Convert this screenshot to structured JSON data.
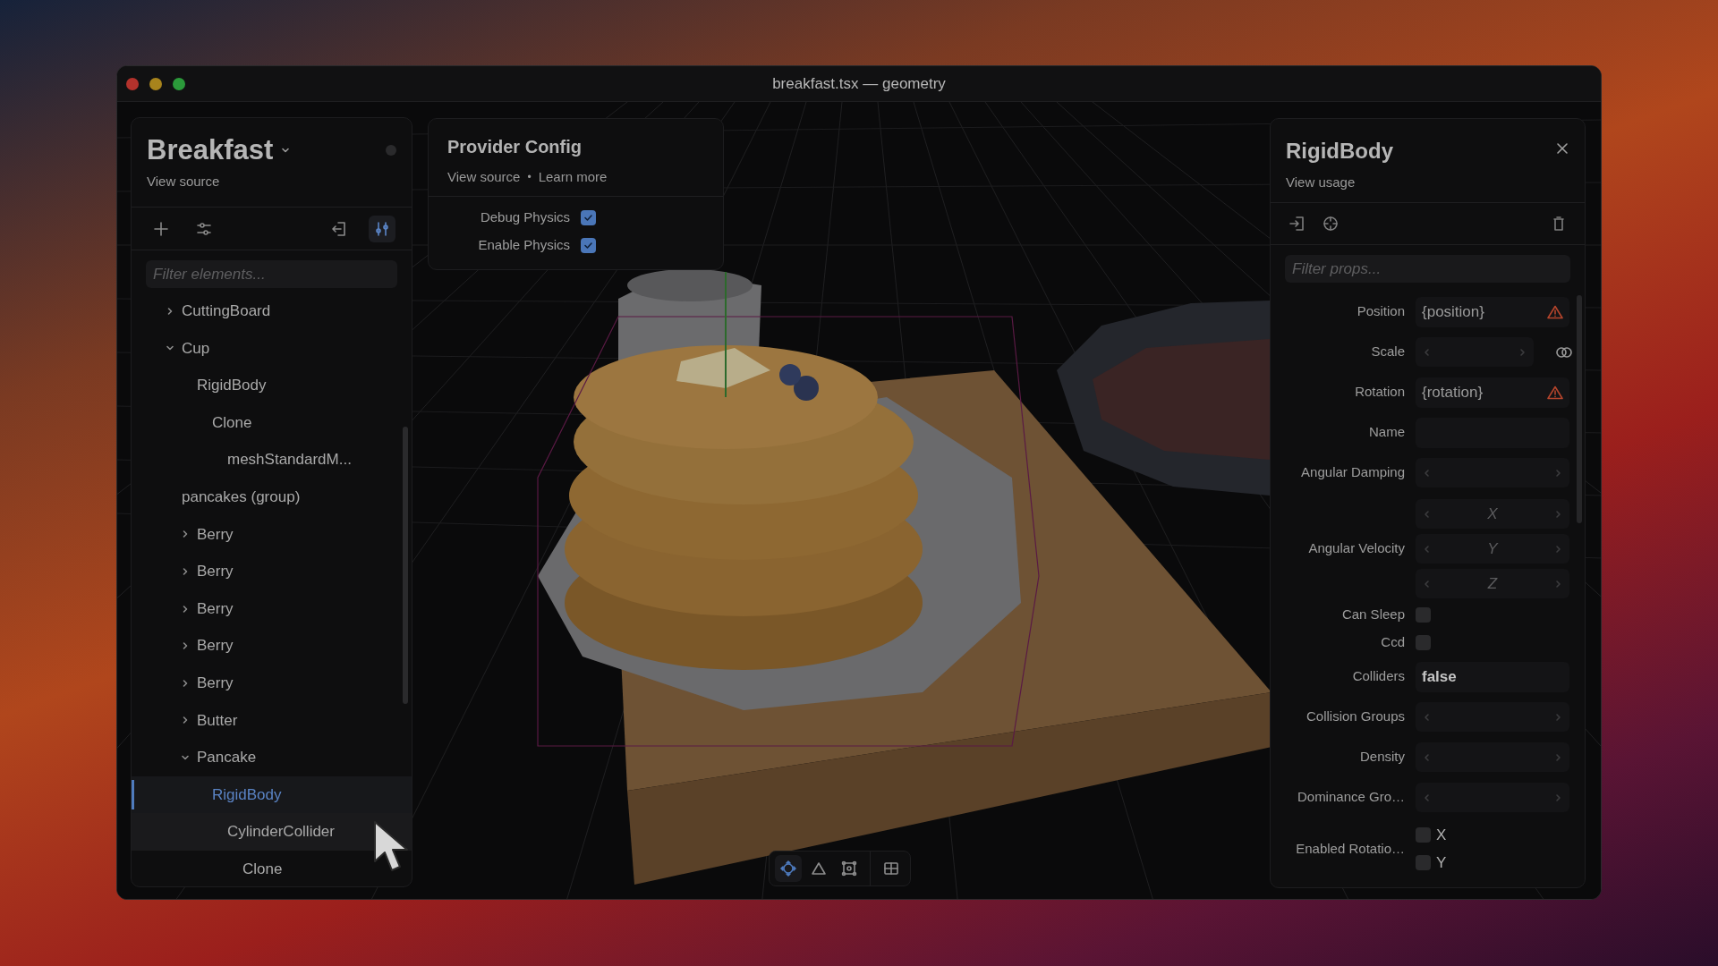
{
  "window": {
    "title": "breakfast.tsx — geometry"
  },
  "scene_panel": {
    "title": "Breakfast",
    "link": "View source",
    "toolbar": [
      {
        "kind": "add",
        "selected": false
      },
      {
        "kind": "filter",
        "selected": false
      },
      {
        "kind": "exit",
        "selected": false
      },
      {
        "kind": "sliders",
        "selected": true
      }
    ],
    "filter": {
      "placeholder": "Filter elements..."
    },
    "tree": [
      {
        "label": "CuttingBoard",
        "expanded": false,
        "selected": false,
        "hovered": false
      },
      {
        "label": "Cup",
        "expanded": true,
        "selected": false,
        "hovered": false,
        "children": [
          {
            "label": "RigidBody",
            "selected": false,
            "hovered": false,
            "children": [
              {
                "label": "Clone",
                "selected": false,
                "hovered": false,
                "children": [
                  {
                    "label": "meshStandardM...",
                    "selected": false,
                    "hovered": false
                  }
                ]
              }
            ]
          }
        ]
      },
      {
        "label": "pancakes (group)",
        "selected": false,
        "hovered": false,
        "children": [
          {
            "label": "Berry",
            "expanded": false,
            "selected": false,
            "hovered": false
          },
          {
            "label": "Berry",
            "expanded": false,
            "selected": false,
            "hovered": false
          },
          {
            "label": "Berry",
            "expanded": false,
            "selected": false,
            "hovered": false
          },
          {
            "label": "Berry",
            "expanded": false,
            "selected": false,
            "hovered": false
          },
          {
            "label": "Berry",
            "expanded": false,
            "selected": false,
            "hovered": false
          },
          {
            "label": "Butter",
            "expanded": false,
            "selected": false,
            "hovered": false
          },
          {
            "label": "Pancake",
            "expanded": true,
            "selected": false,
            "hovered": false,
            "children": [
              {
                "label": "RigidBody",
                "selected": true,
                "hovered": false,
                "children": [
                  {
                    "label": "CylinderCollider",
                    "selected": false,
                    "hovered": true,
                    "children": [
                      {
                        "label": "Clone",
                        "selected": false,
                        "hovered": false
                      }
                    ]
                  }
                ]
              }
            ]
          }
        ]
      }
    ]
  },
  "provider_config": {
    "title": "Provider Config",
    "links": [
      "View source",
      "Learn more"
    ],
    "separator": "•",
    "options": [
      {
        "label": "Debug Physics",
        "checked": true
      },
      {
        "label": "Enable Physics",
        "checked": true
      }
    ]
  },
  "inspector": {
    "title": "RigidBody",
    "link": "View usage",
    "toolbar": [
      {
        "kind": "enter"
      },
      {
        "kind": "crosshair"
      },
      {
        "kind": "trash"
      }
    ],
    "filter": {
      "placeholder": "Filter props..."
    },
    "props": [
      {
        "label": "Position",
        "kind": "text",
        "value": "{position}",
        "warning": true
      },
      {
        "label": "Scale",
        "kind": "linked_stepper"
      },
      {
        "label": "Rotation",
        "kind": "text",
        "value": "{rotation}",
        "warning": true
      },
      {
        "label": "Name",
        "kind": "text",
        "warning": false
      },
      {
        "label": "Angular Damping",
        "kind": "stepper"
      },
      {
        "label": "Angular Velocity",
        "kind": "vector",
        "axes": [
          "X",
          "Y",
          "Z"
        ]
      },
      {
        "label": "Can Sleep",
        "kind": "checkbox",
        "checked": false
      },
      {
        "label": "Ccd",
        "kind": "checkbox",
        "checked": false
      },
      {
        "label": "Colliders",
        "kind": "text",
        "value": "false",
        "warning": false
      },
      {
        "label": "Collision Groups",
        "kind": "stepper"
      },
      {
        "label": "Density",
        "kind": "stepper"
      },
      {
        "label": "Dominance Gro…",
        "kind": "stepper"
      },
      {
        "label": "Enabled Rotatio…",
        "kind": "checks",
        "items": [
          {
            "label": "X",
            "checked": false
          },
          {
            "label": "Y",
            "checked": false
          }
        ]
      }
    ]
  },
  "viewport_toolbar": {
    "tools": [
      {
        "kind": "move",
        "selected": true
      },
      {
        "kind": "triangle",
        "selected": false
      },
      {
        "kind": "frame",
        "selected": false
      },
      {
        "kind": "grid",
        "selected": false
      }
    ]
  }
}
